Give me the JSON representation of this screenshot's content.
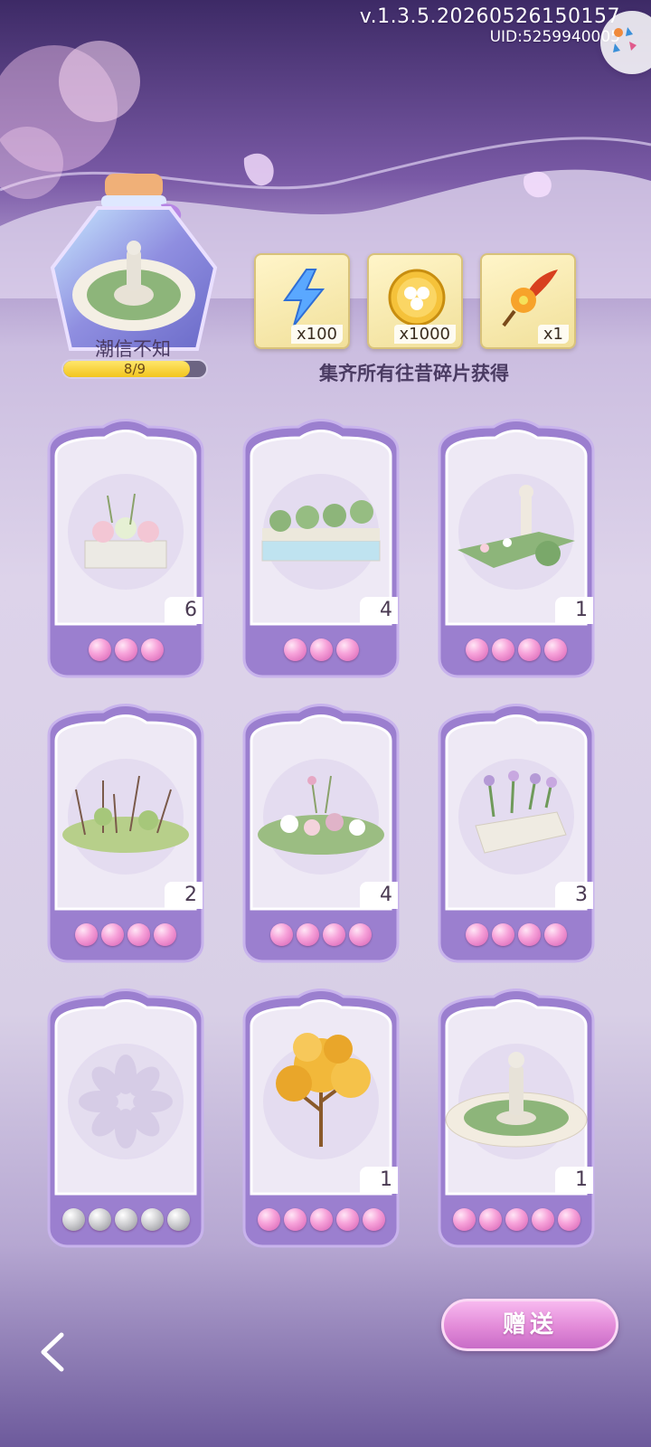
{
  "version": "v.1.3.5.20260526150157",
  "uid": "UID:5259940005",
  "bottle": {
    "name": "潮信不知",
    "progress_text": "8/9",
    "progress_value": 0.889
  },
  "rewards": [
    {
      "icon": "lightning-icon",
      "qty": "x100"
    },
    {
      "icon": "gold-clover-coin-icon",
      "qty": "x1000"
    },
    {
      "icon": "flower-feather-icon",
      "qty": "x1"
    }
  ],
  "collect_text": "集齐所有往昔碎片获得",
  "cards": [
    {
      "item": "flower-planter-box",
      "count": "6",
      "pearls": 3,
      "pearl_color": "pink"
    },
    {
      "item": "fountain-hedge-wall",
      "count": "4",
      "pearls": 3,
      "pearl_color": "pink"
    },
    {
      "item": "garden-bed-with-pillar",
      "count": "1",
      "pearls": 4,
      "pearl_color": "pink"
    },
    {
      "item": "wild-grass-bush",
      "count": "2",
      "pearls": 4,
      "pearl_color": "pink"
    },
    {
      "item": "rose-flower-bed",
      "count": "4",
      "pearls": 4,
      "pearl_color": "pink"
    },
    {
      "item": "iris-planter",
      "count": "3",
      "pearls": 4,
      "pearl_color": "pink"
    },
    {
      "item": "locked-flower-placeholder",
      "count": "",
      "pearls": 5,
      "pearl_color": "gray"
    },
    {
      "item": "golden-maple-tree",
      "count": "1",
      "pearls": 5,
      "pearl_color": "pink"
    },
    {
      "item": "statue-fountain-garden",
      "count": "1",
      "pearls": 5,
      "pearl_color": "pink"
    }
  ],
  "gift_button": "赠送",
  "colors": {
    "card_purple": "#9b7fcf",
    "card_inner": "#eee9f5",
    "pearl_pink": "#ee8fd0",
    "button_pink": "#e28ad8"
  }
}
